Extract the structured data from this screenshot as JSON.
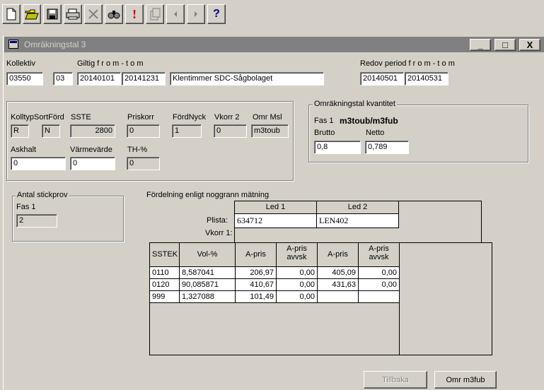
{
  "window": {
    "title": "Omräkningstal 3",
    "minimize": "_",
    "maximize": "□",
    "close": "X"
  },
  "header": {
    "kollektiv_label": "Kollektiv",
    "kollektiv_value": "03550",
    "sub_value": "03",
    "giltig_label": "Giltig f r o m - t o m",
    "giltig_from": "20140101",
    "giltig_to": "20141231",
    "description": "Klentimmer SDC-Sågbolaget",
    "redov_label": "Redov period  f r o m - t o m",
    "redov_from": "20140501",
    "redov_to": "20140531"
  },
  "params": {
    "kolltyp_label": "Kolltyp",
    "kolltyp_value": "R",
    "sortford_label": "SortFörd",
    "sortford_value": "N",
    "sste_label": "SSTE",
    "sste_value": "2800",
    "priskorr_label": "Priskorr",
    "priskorr_value": "0",
    "fordnyck_label": "FördNyck",
    "fordnyck_value": "1",
    "vkorr2_label": "Vkorr 2",
    "vkorr2_value": "0",
    "ommsl_label": "Omr Msl",
    "ommsl_value": "m3toub",
    "askhalt_label": "Askhalt",
    "askhalt_value": "0",
    "varmevarde_label": "Värmevärde",
    "varmevarde_value": "0",
    "th_label": "TH-%",
    "th_value": "0"
  },
  "kvantitet": {
    "legend": "Omräkningstal kvantitet",
    "fas_label": "Fas 1",
    "fas_unit": "m3toub/m3fub",
    "brutto_label": "Brutto",
    "brutto_value": "0,8",
    "netto_label": "Netto",
    "netto_value": "0,789"
  },
  "stickprov": {
    "legend": "Antal stickprov",
    "fas_label": "Fas 1",
    "value": "2"
  },
  "fordelning": {
    "title": "Fördelning enligt noggrann mätning",
    "led1": "Led 1",
    "led2": "Led 2",
    "plista_label": "Plista:",
    "plista_led1": "634712",
    "plista_led2": "LEN402",
    "vkorr1_label": "Vkorr 1:",
    "columns": [
      "SSTEK",
      "Vol-%",
      "A-pris",
      "A-pris avvsk",
      "A-pris",
      "A-pris avvsk"
    ],
    "rows": [
      [
        "0110",
        "8,587041",
        "206,97",
        "0,00",
        "405,09",
        "0,00"
      ],
      [
        "0120",
        "90,085871",
        "410,67",
        "0,00",
        "431,63",
        "0,00"
      ],
      [
        "999",
        "1,327088",
        "101,49",
        "0,00",
        "",
        ""
      ]
    ]
  },
  "buttons": {
    "tillbaka": "Tillbaka",
    "omr": "Omr m3fub"
  },
  "toolbar": {
    "icons": [
      "new-icon",
      "open-icon",
      "save-icon",
      "print-icon",
      "delete-icon",
      "find-icon",
      "alert-icon",
      "copy-icon",
      "prev-icon",
      "next-icon",
      "help-icon"
    ],
    "help_glyph": "?",
    "alert_glyph": "!"
  }
}
